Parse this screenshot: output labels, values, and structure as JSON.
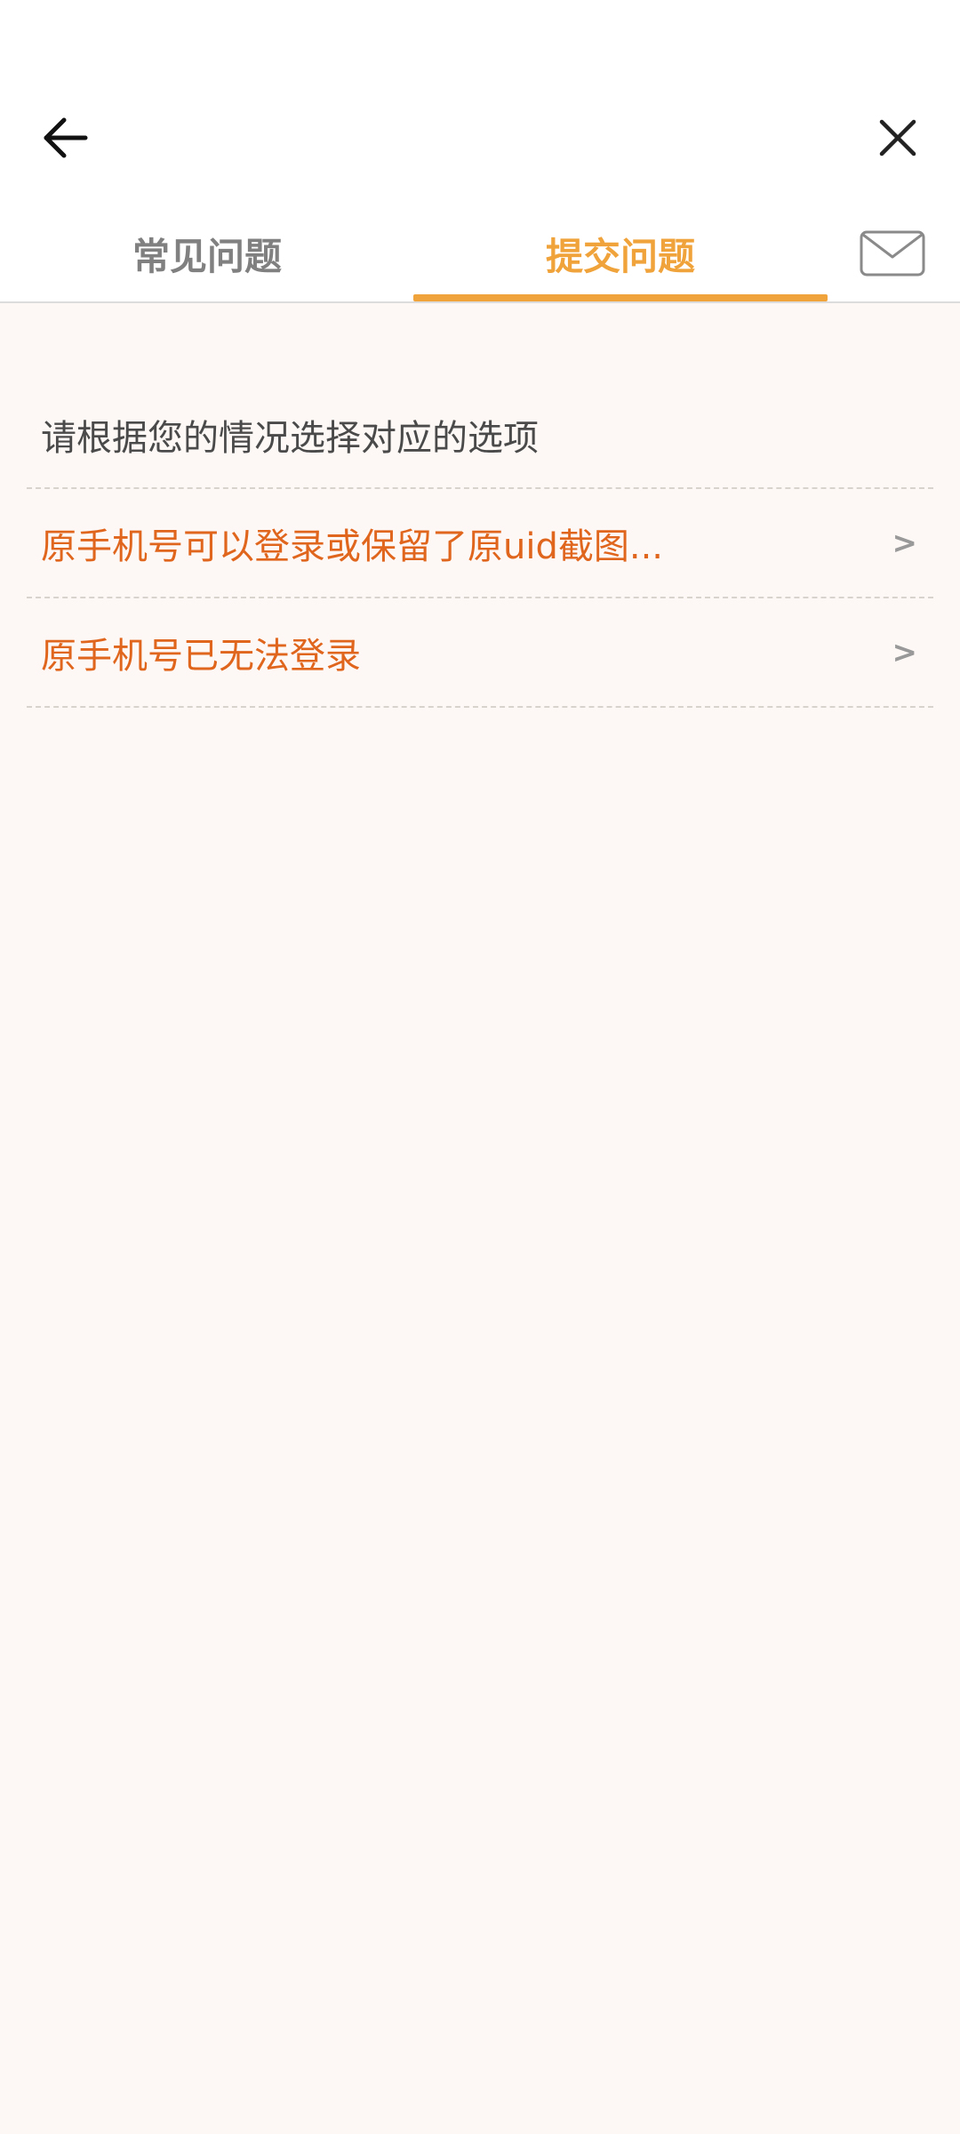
{
  "tabs": [
    {
      "label": "常见问题",
      "active": false
    },
    {
      "label": "提交问题",
      "active": true
    }
  ],
  "icons": {
    "back": "arrow-left-icon",
    "close": "close-icon",
    "mail": "mail-icon"
  },
  "prompt": "请根据您的情况选择对应的选项",
  "options": [
    {
      "label": "原手机号可以登录或保留了原uid截图...",
      "chevron": ">"
    },
    {
      "label": "原手机号已无法登录",
      "chevron": ">"
    }
  ],
  "colors": {
    "accent": "#f0a33a",
    "option_text": "#e0651d",
    "background": "#fdf8f5",
    "inactive_tab": "#808080"
  }
}
